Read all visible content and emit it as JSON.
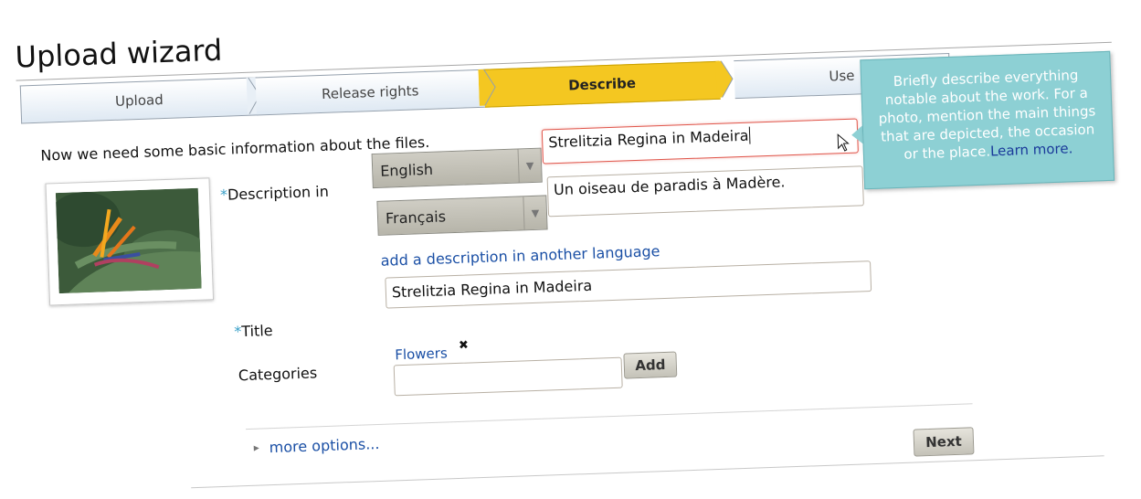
{
  "page": {
    "title": "Upload wizard",
    "intro": "Now we need some basic information about the files."
  },
  "steps": [
    {
      "label": "Upload",
      "active": false
    },
    {
      "label": "Release rights",
      "active": false
    },
    {
      "label": "Describe",
      "active": true
    },
    {
      "label": "Use",
      "active": false
    }
  ],
  "description": {
    "label_star": "*",
    "label": "Description in",
    "rows": [
      {
        "language": "English",
        "text": "Strelitzia Regina in Madeira"
      },
      {
        "language": "Français",
        "text": "Un oiseau de paradis à Madère."
      }
    ],
    "add_link": "add a description in another language"
  },
  "title_field": {
    "label_star": "*",
    "label": "Title",
    "value": "Strelitzia Regina in Madeira"
  },
  "categories": {
    "label": "Categories",
    "items": [
      "Flowers"
    ],
    "remove_symbol": "✖",
    "input_value": "",
    "add_button": "Add"
  },
  "more_options": {
    "arrow": "▸",
    "label": "more options..."
  },
  "next_button": "Next",
  "tooltip": {
    "text": "Briefly describe everything notable about the work. For a photo, mention the main things that are depicted, the occasion or the place.",
    "link": "Learn more."
  },
  "dropdown_arrow": "▼",
  "colors": {
    "active_step": "#f4c721",
    "link": "#1a4fa5",
    "tooltip_bg": "#8dd0d4",
    "focus_border": "#e0554a",
    "required_star": "#3aa0c8"
  }
}
